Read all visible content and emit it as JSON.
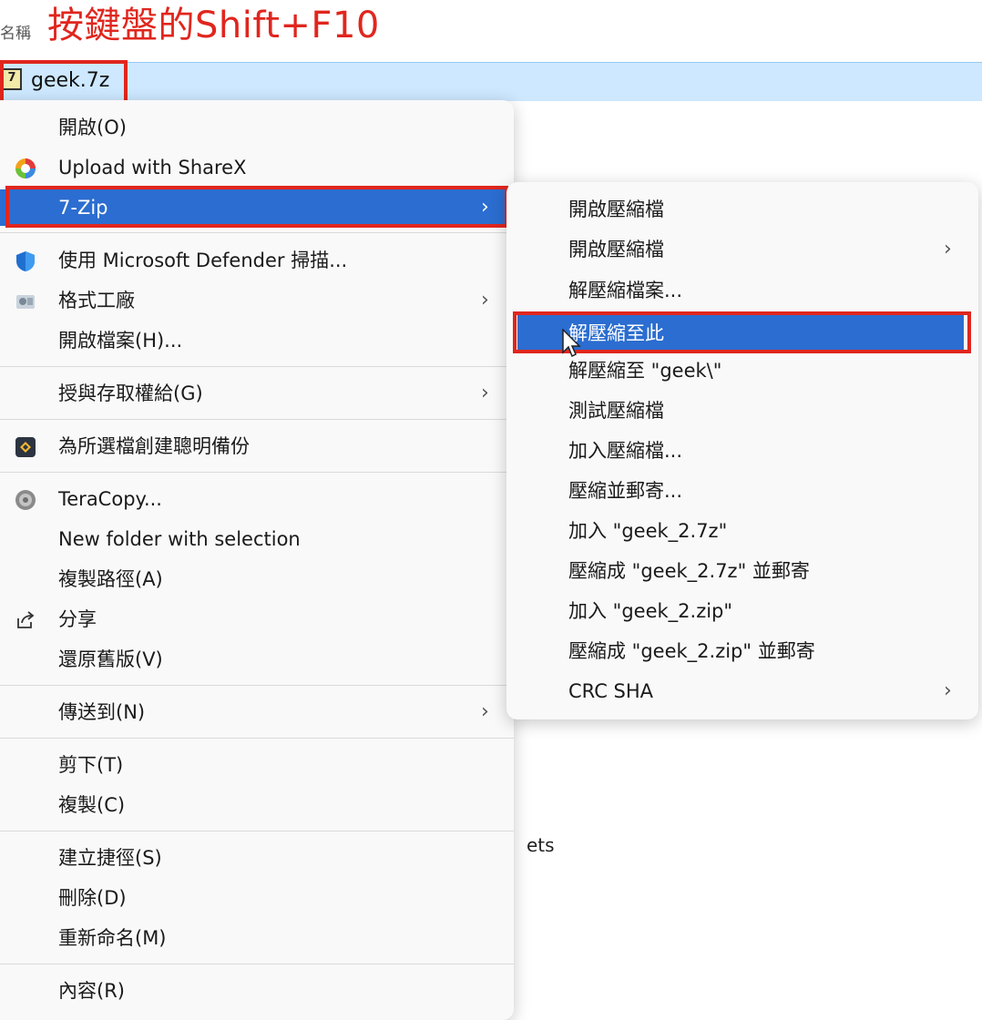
{
  "header": {
    "column_name": "名稱",
    "annotation": "按鍵盤的Shift+F10"
  },
  "file": {
    "name": "geek.7z",
    "icon_glyph": "7"
  },
  "main_menu": {
    "items": [
      {
        "label": "開啟(O)",
        "icon": ""
      },
      {
        "label": "Upload with ShareX",
        "icon": "sharex-icon"
      },
      {
        "label": "7-Zip",
        "icon": "",
        "selected": true,
        "submenu": true
      },
      {
        "label": "使用 Microsoft Defender 掃描...",
        "icon": "defender-shield-icon"
      },
      {
        "label": "格式工廠",
        "icon": "format-factory-icon",
        "submenu": true
      },
      {
        "label": "開啟檔案(H)...",
        "icon": ""
      },
      {
        "label": "授與存取權給(G)",
        "icon": "",
        "submenu": true
      },
      {
        "label": "為所選檔創建聰明備份",
        "icon": "backup-icon"
      },
      {
        "label": "TeraCopy...",
        "icon": "teracopy-icon"
      },
      {
        "label": "New folder with selection",
        "icon": ""
      },
      {
        "label": "複製路徑(A)",
        "icon": ""
      },
      {
        "label": "分享",
        "icon": "share-icon"
      },
      {
        "label": "還原舊版(V)",
        "icon": ""
      },
      {
        "label": "傳送到(N)",
        "icon": "",
        "submenu": true
      },
      {
        "label": "剪下(T)",
        "icon": ""
      },
      {
        "label": "複製(C)",
        "icon": ""
      },
      {
        "label": "建立捷徑(S)",
        "icon": ""
      },
      {
        "label": "刪除(D)",
        "icon": ""
      },
      {
        "label": "重新命名(M)",
        "icon": ""
      },
      {
        "label": "內容(R)",
        "icon": ""
      }
    ]
  },
  "sub_menu": {
    "items": [
      {
        "label": "開啟壓縮檔"
      },
      {
        "label": "開啟壓縮檔",
        "submenu": true
      },
      {
        "label": "解壓縮檔案..."
      },
      {
        "label": "解壓縮至此",
        "selected": true
      },
      {
        "label": "解壓縮至 \"geek\\\""
      },
      {
        "label": "測試壓縮檔"
      },
      {
        "label": "加入壓縮檔..."
      },
      {
        "label": "壓縮並郵寄..."
      },
      {
        "label": "加入 \"geek_2.7z\""
      },
      {
        "label": "壓縮成 \"geek_2.7z\" 並郵寄"
      },
      {
        "label": "加入 \"geek_2.zip\""
      },
      {
        "label": "壓縮成 \"geek_2.zip\" 並郵寄"
      },
      {
        "label": "CRC SHA",
        "submenu": true
      }
    ]
  },
  "background_text": "ets",
  "colors": {
    "highlight": "#2b6dd0",
    "annotation_red": "#e0261e",
    "file_row": "#cde8ff"
  }
}
